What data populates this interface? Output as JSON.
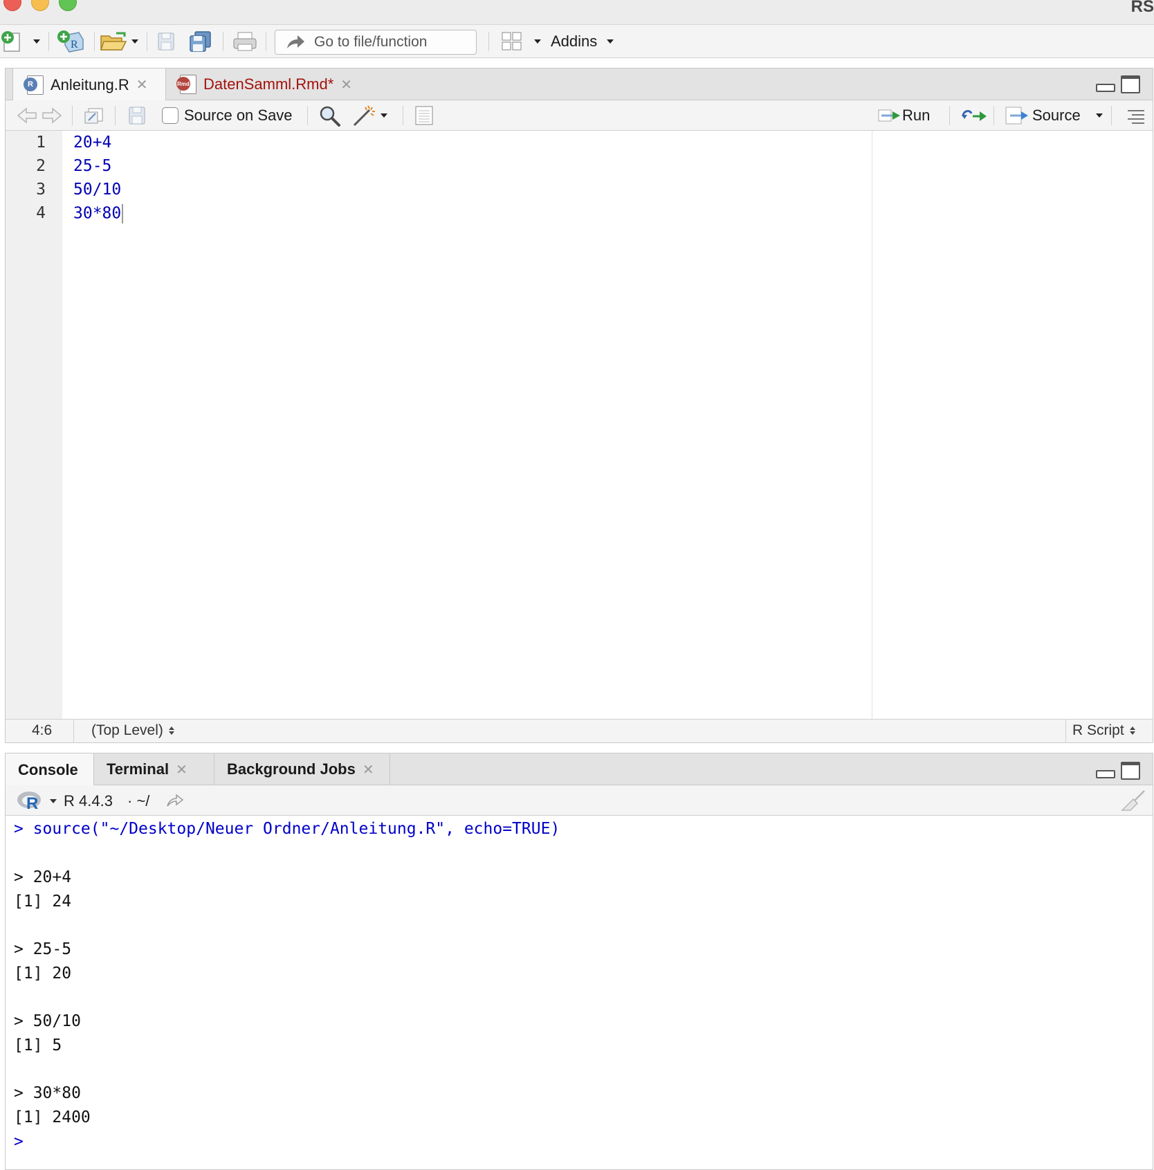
{
  "window": {
    "app_title": "RS"
  },
  "main_toolbar": {
    "goto_placeholder": "Go to file/function",
    "addins_label": "Addins"
  },
  "source_pane": {
    "tabs": [
      {
        "label": "Anleitung.R",
        "icon": "r-file-icon",
        "active": true,
        "color": "#1a1a1a"
      },
      {
        "label": "DatenSamml.Rmd*",
        "icon": "rmd-file-icon",
        "active": false,
        "color": "#a3120c"
      }
    ],
    "toolbar": {
      "source_on_save_label": "Source on Save",
      "source_on_save_checked": false,
      "run_label": "Run",
      "source_label": "Source"
    },
    "line_numbers": [
      "1",
      "2",
      "3",
      "4"
    ],
    "code_lines": [
      "20+4",
      "25-5",
      "50/10",
      "30*80"
    ],
    "status": {
      "cursor_pos": "4:6",
      "scope": "(Top Level)",
      "file_type": "R Script"
    }
  },
  "console_pane": {
    "tabs": [
      {
        "label": "Console",
        "active": true
      },
      {
        "label": "Terminal",
        "active": false
      },
      {
        "label": "Background Jobs",
        "active": false
      }
    ],
    "r_version": "R 4.4.3",
    "working_dir": "· ~/",
    "lines": [
      {
        "text": "> source(\"~/Desktop/Neuer Ordner/Anleitung.R\", echo=TRUE)",
        "color": "blue"
      },
      {
        "text": "> 20+4",
        "color": "black"
      },
      {
        "text": "[1] 24",
        "color": "black"
      },
      {
        "text": "> 25-5",
        "color": "black"
      },
      {
        "text": "[1] 20",
        "color": "black"
      },
      {
        "text": "> 50/10",
        "color": "black"
      },
      {
        "text": "[1] 5",
        "color": "black"
      },
      {
        "text": "> 30*80",
        "color": "black"
      },
      {
        "text": "[1] 2400",
        "color": "black"
      },
      {
        "text": ">",
        "color": "blue"
      }
    ]
  },
  "colors": {
    "code_blue": "#0000b4",
    "console_blue": "#0000c8",
    "rmd_tab_red": "#a3120c",
    "run_green": "#2e9a3c"
  }
}
